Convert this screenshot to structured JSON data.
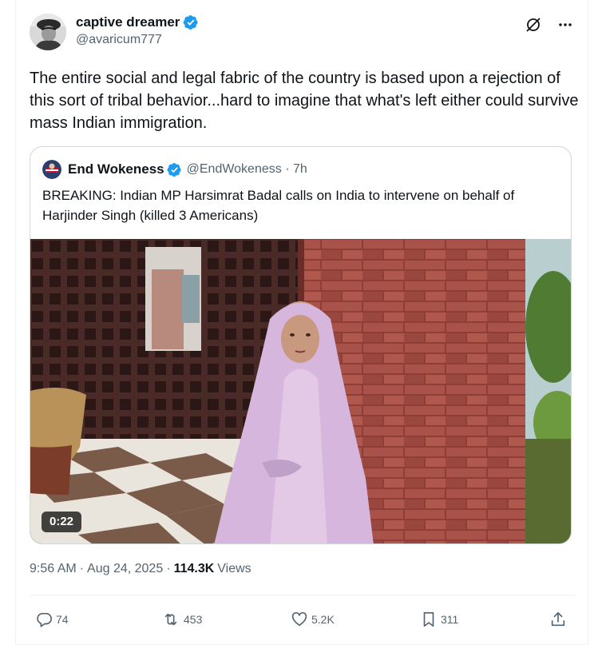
{
  "tweet": {
    "display_name": "captive dreamer",
    "handle": "@avaricum777",
    "text": "The entire social and legal fabric of the country is based upon a rejection of this sort of tribal behavior...hard to imagine that what's left either could survive mass Indian immigration.",
    "time": "9:56 AM",
    "date": "Aug 24, 2025",
    "views_count": "114.3K",
    "views_label": "Views"
  },
  "quote": {
    "display_name": "End Wokeness",
    "handle": "@EndWokeness",
    "age": "7h",
    "text": "BREAKING: Indian MP Harsimrat Badal calls on India to intervene on behalf of Harjinder Singh (killed 3 Americans)",
    "video_duration": "0:22"
  },
  "actions": {
    "replies": "74",
    "reposts": "453",
    "likes": "5.2K",
    "bookmarks": "311"
  },
  "colors": {
    "verified": "#1d9bf0",
    "secondary_text": "#536471",
    "border": "#cfd9de"
  },
  "icons": [
    "verified-badge-icon",
    "grok-icon",
    "more-icon",
    "reply-icon",
    "repost-icon",
    "like-icon",
    "bookmark-icon",
    "share-icon"
  ]
}
